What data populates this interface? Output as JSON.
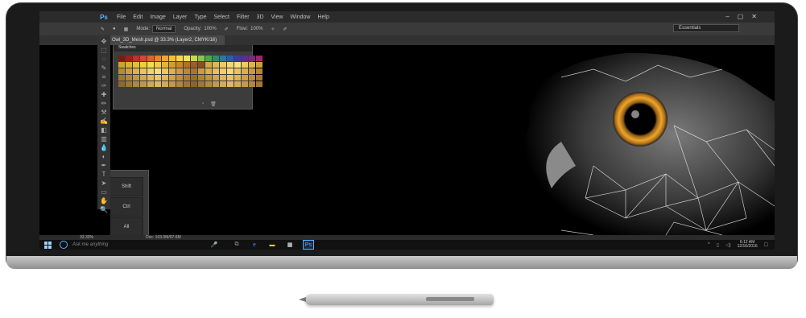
{
  "app": {
    "logo": "Ps",
    "menu": [
      "File",
      "Edit",
      "Image",
      "Layer",
      "Type",
      "Select",
      "Filter",
      "3D",
      "View",
      "Window",
      "Help"
    ]
  },
  "options": {
    "mode_label": "Mode:",
    "mode_value": "Normal",
    "opacity_label": "Opacity:",
    "opacity_value": "100%",
    "flow_label": "Flow:",
    "flow_value": "100%",
    "workspace": "Essentials"
  },
  "document": {
    "tab_title": "Owl_3D_Mesh.psd @ 33.3% (Layer2, CMYK/16)"
  },
  "swatches": {
    "title": "Swatches",
    "colors": [
      "#7a1a1a",
      "#9a2222",
      "#c0302a",
      "#d6443a",
      "#e0632e",
      "#e8842c",
      "#eda52c",
      "#f2c12e",
      "#f5d84a",
      "#eee060",
      "#c9d84a",
      "#8fc24a",
      "#4aa84c",
      "#2f8e6a",
      "#2a7a9a",
      "#2a5ea8",
      "#3a3e9e",
      "#5a2e8e",
      "#7a2a7a",
      "#9a2a5a",
      "#caa52c",
      "#d8b22e",
      "#e4c02e",
      "#f0d03a",
      "#f6dc52",
      "#f2c94a",
      "#e6b23c",
      "#d89c30",
      "#c8862a",
      "#b47028",
      "#9e5e26",
      "#8a5024",
      "#d2a84a",
      "#e0b85a",
      "#ecc86a",
      "#f4d67a",
      "#f8e08a",
      "#eecb5e",
      "#deb44a",
      "#cc9e3e",
      "#b88a36",
      "#caa040",
      "#dab44c",
      "#e8c65a",
      "#f2d468",
      "#f6de76",
      "#ecc85c",
      "#dcb24a",
      "#cc9c3e",
      "#ba8836",
      "#a8762e",
      "#c89e42",
      "#d8b04e",
      "#e6c05a",
      "#f0ce66",
      "#f6da72",
      "#eac45a",
      "#dab048",
      "#c89a3c",
      "#b68632",
      "#9e7a2e",
      "#b0883a",
      "#c29846",
      "#d2a852",
      "#e0b85e",
      "#ecc66a",
      "#e2b65a",
      "#d2a24a",
      "#c08e3e",
      "#ae7c34",
      "#9a6c2c",
      "#ae8238",
      "#c09444",
      "#d0a450",
      "#deb45c",
      "#eac268",
      "#e0b258",
      "#cfa048",
      "#bc8c3c",
      "#a87a32",
      "#8a6a28",
      "#9c7832",
      "#ae883e",
      "#c0984a",
      "#d0a856",
      "#deb662",
      "#d4aa56",
      "#c49848",
      "#b2863c",
      "#a07432",
      "#8c6428",
      "#a07834",
      "#b28a40",
      "#c29a4c",
      "#d2aa58",
      "#e0b864",
      "#d6ac58",
      "#c69a4a",
      "#b4883e",
      "#a27634"
    ]
  },
  "modifiers": [
    "Shift",
    "Ctrl",
    "All"
  ],
  "status": {
    "zoom": "33.33%",
    "doc": "Doc: 103.0M/97.6M"
  },
  "taskbar": {
    "search_placeholder": "Ask me anything",
    "time": "6:12 AM",
    "date": "12/16/2016"
  }
}
